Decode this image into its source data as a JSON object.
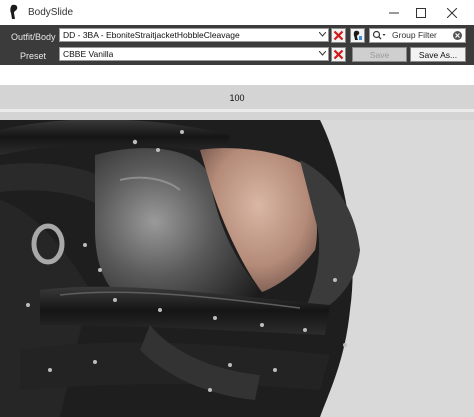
{
  "window": {
    "title": "BodySlide",
    "icon": "bodyslide-app-icon"
  },
  "outfit": {
    "label": "Outfit/Body",
    "value": "DD - 3BA - EboniteStraitjacketHobbleCleavage"
  },
  "preset": {
    "label": "Preset",
    "value": "CBBE Vanilla"
  },
  "filter": {
    "placeholder": "Group Filter"
  },
  "buttons": {
    "save": "Save",
    "save_as": "Save As..."
  },
  "slider": {
    "value": "100"
  },
  "colors": {
    "toolbar": "#3b3b3b",
    "delete_red": "#d21a1a",
    "viewport_bg": "#d9d9d9"
  }
}
